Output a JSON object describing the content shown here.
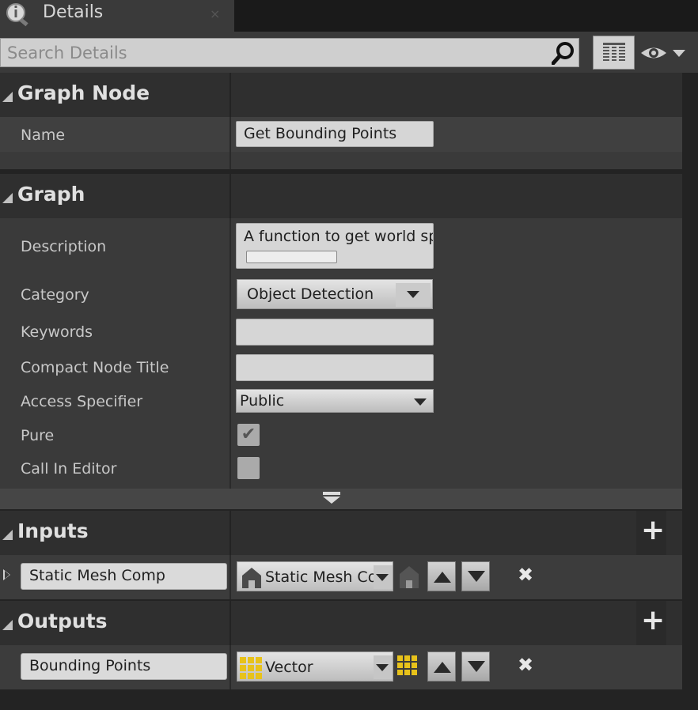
{
  "tab": {
    "title": "Details",
    "close_glyph": "×"
  },
  "search": {
    "placeholder": "Search Details",
    "value": ""
  },
  "sections": {
    "graph_node": {
      "title": "Graph Node",
      "name_label": "Name",
      "name_value": "Get Bounding Points"
    },
    "graph": {
      "title": "Graph",
      "description_label": "Description",
      "description_value": "A function to get world sp",
      "category_label": "Category",
      "category_value": "Object Detection",
      "keywords_label": "Keywords",
      "keywords_value": "",
      "compact_title_label": "Compact Node Title",
      "compact_title_value": "",
      "access_label": "Access Specifier",
      "access_value": "Public",
      "pure_label": "Pure",
      "pure_checked": true,
      "call_in_editor_label": "Call In Editor",
      "call_in_editor_checked": false
    },
    "inputs": {
      "title": "Inputs",
      "items": [
        {
          "name": "Static Mesh Comp",
          "type": "Static Mesh Co",
          "type_icon": "static-mesh-icon"
        }
      ]
    },
    "outputs": {
      "title": "Outputs",
      "items": [
        {
          "name": "Bounding Points",
          "type": "Vector",
          "type_icon": "vector-grid-icon"
        }
      ]
    }
  },
  "colors": {
    "panel": "#3a3a3a",
    "header": "#2f2f2f",
    "vector_yellow": "#e8c21a"
  },
  "glyphs": {
    "plus": "+",
    "remove": "✖",
    "check": "✔"
  }
}
